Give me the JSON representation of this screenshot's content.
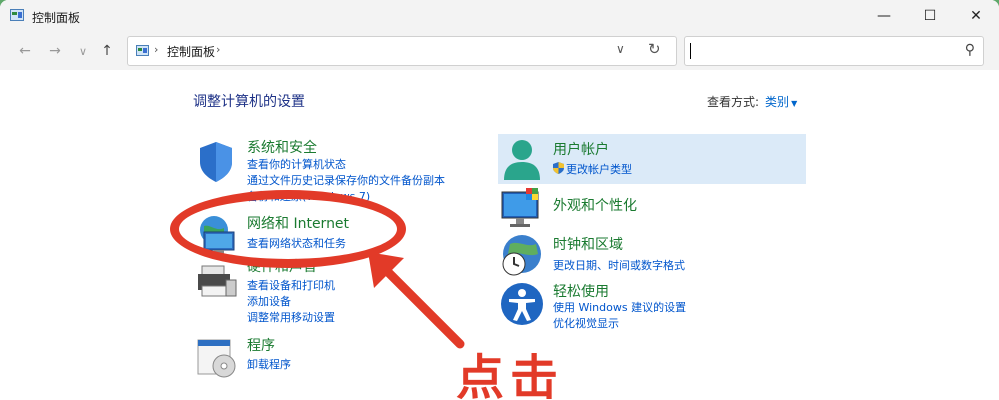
{
  "window": {
    "title": "控制面板",
    "min_glyph": "—",
    "max_glyph": "☐",
    "close_glyph": "✕"
  },
  "nav": {
    "back_glyph": "←",
    "forward_glyph": "→",
    "recent_glyph": "∨",
    "up_glyph": "↑",
    "breadcrumb_sep": "›",
    "breadcrumb": "控制面板",
    "dropdown_glyph": "∨",
    "refresh_glyph": "↻",
    "search_value": "",
    "search_glyph": "⚲"
  },
  "main": {
    "heading": "调整计算机的设置",
    "view_by_label": "查看方式:",
    "view_by_value": "类别",
    "view_by_arrow": "▼"
  },
  "left_categories": [
    {
      "title": "系统和安全",
      "links": [
        "查看你的计算机状态",
        "通过文件历史记录保存你的文件备份副本",
        "备份和还原(Windows 7)"
      ]
    },
    {
      "title": "网络和 Internet",
      "links": [
        "查看网络状态和任务"
      ]
    },
    {
      "title": "硬件和声音",
      "links": [
        "查看设备和打印机",
        "添加设备",
        "调整常用移动设置"
      ]
    },
    {
      "title": "程序",
      "links": [
        "卸载程序"
      ]
    }
  ],
  "right_categories": [
    {
      "title": "用户帐户",
      "links": [
        "更改帐户类型"
      ]
    },
    {
      "title": "外观和个性化",
      "links": []
    },
    {
      "title": "时钟和区域",
      "links": [
        "更改日期、时间或数字格式"
      ]
    },
    {
      "title": "轻松使用",
      "links": [
        "使用 Windows 建议的设置",
        "优化视觉显示"
      ]
    }
  ],
  "annotation": {
    "text": "点击"
  },
  "colors": {
    "category_title": "#1a7a30",
    "link": "#0055cc",
    "heading": "#1e3287",
    "annotation": "#e23a28",
    "highlight": "#dbeaf8"
  }
}
